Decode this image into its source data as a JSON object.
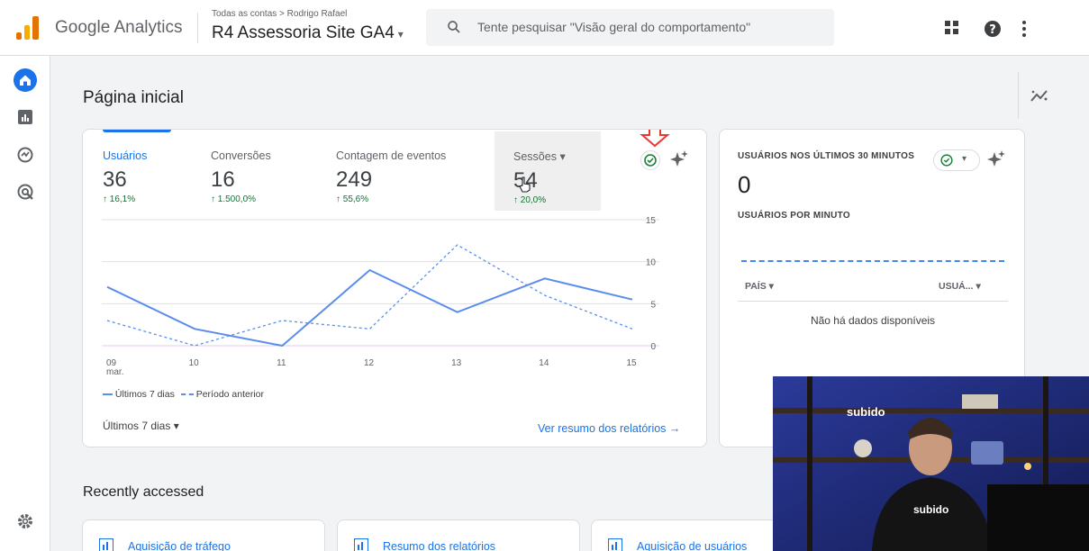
{
  "header": {
    "brand": "Google Analytics",
    "breadcrumb": "Todas as contas > Rodrigo Rafael",
    "property": "R4 Assessoria Site GA4",
    "search_placeholder": "Tente pesquisar \"Visão geral do comportamento\"",
    "icons": [
      "apps-icon",
      "help-icon",
      "more-vert-icon"
    ]
  },
  "nav": {
    "items": [
      "home-icon",
      "reports-icon",
      "explore-icon",
      "advertising-icon"
    ],
    "settings": "gear-icon"
  },
  "page": {
    "title": "Página inicial"
  },
  "metrics": [
    {
      "label": "Usuários",
      "value": "36",
      "change": "↑ 16,1%"
    },
    {
      "label": "Conversões",
      "value": "16",
      "change": "↑ 1.500,0%"
    },
    {
      "label": "Contagem de eventos",
      "value": "249",
      "change": "↑ 55,6%"
    },
    {
      "label": "Sessões",
      "value": "54",
      "change": "↑ 20,0%"
    }
  ],
  "chart_data": {
    "type": "line",
    "categories": [
      "09\nmar.",
      "10",
      "11",
      "12",
      "13",
      "14",
      "15"
    ],
    "x_tick_labels": [
      "09",
      "10",
      "11",
      "12",
      "13",
      "14",
      "15"
    ],
    "x_first_sublabel": "mar.",
    "y_ticks": [
      "0",
      "5",
      "10",
      "15"
    ],
    "ylim": [
      0,
      15
    ],
    "grid": true,
    "series": [
      {
        "name": "Últimos 7 dias",
        "values": [
          7,
          2,
          0,
          9,
          4,
          8,
          5.5
        ]
      },
      {
        "name": "Período anterior",
        "values": [
          3,
          0,
          3,
          2,
          12,
          6,
          2
        ]
      }
    ],
    "colors": {
      "current": "#5b8def",
      "previous": "#5b8def"
    }
  },
  "legend": {
    "current": "Últimos 7 dias",
    "previous": "Período anterior"
  },
  "footer": {
    "range": "Últimos 7 dias",
    "report_link": "Ver resumo dos relatórios"
  },
  "realtime": {
    "title": "USUÁRIOS NOS ÚLTIMOS 30 MINUTOS",
    "value": "0",
    "subtitle": "USUÁRIOS POR MINUTO",
    "col_country": "PAÍS",
    "col_users": "USUÁ...",
    "empty": "Não há dados disponíveis"
  },
  "recent": {
    "title": "Recently accessed",
    "items": [
      "Aquisição de tráfego",
      "Resumo dos relatórios",
      "Aquisição de usuários"
    ]
  },
  "video": {
    "shirt_text": "subido",
    "sign_text": "subido"
  },
  "colors": {
    "accent": "#1a73e8",
    "positive": "#137333",
    "annotation": "#e53935"
  }
}
